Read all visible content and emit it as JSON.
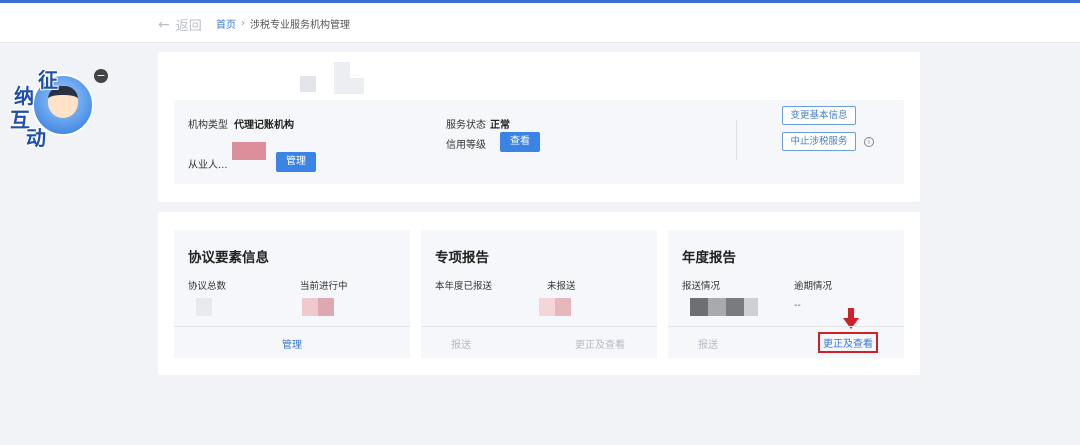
{
  "header": {
    "back_label": "返回",
    "breadcrumb_home": "首页",
    "breadcrumb_sep": "›",
    "breadcrumb_current": "涉税专业服务机构管理"
  },
  "mascot": {
    "chars": [
      "征",
      "纳",
      "互",
      "动"
    ],
    "close_symbol": "−"
  },
  "org_info": {
    "type_label": "机构类型",
    "type_value": "代理记账机构",
    "staff_label": "从业人...",
    "manage_button": "管理",
    "status_label": "服务状态",
    "status_value": "正常",
    "credit_label": "信用等级",
    "view_button": "查看",
    "change_info_button": "变更基本信息",
    "stop_service_button": "中止涉税服务",
    "info_icon": "i"
  },
  "panels": [
    {
      "title": "协议要素信息",
      "col1_label": "协议总数",
      "col2_label": "当前进行中",
      "foot_center": "管理"
    },
    {
      "title": "专项报告",
      "col1_label": "本年度已报送",
      "col2_label": "未报送",
      "foot_left": "报送",
      "foot_right": "更正及查看"
    },
    {
      "title": "年度报告",
      "col1_label": "报送情况",
      "col2_label": "逾期情况",
      "col2_value": "--",
      "foot_left": "报送",
      "foot_right": "更正及查看"
    }
  ],
  "colors": {
    "accent": "#3c84e4",
    "highlight": "#d0202a"
  }
}
